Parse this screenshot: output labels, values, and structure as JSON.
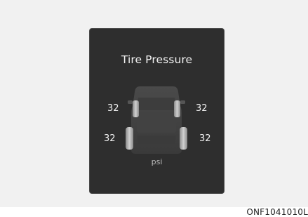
{
  "screen": {
    "title": "Tire Pressure",
    "unit": "psi"
  },
  "tires": {
    "front_left": "32",
    "front_right": "32",
    "rear_left": "32",
    "rear_right": "32"
  },
  "figure_code": "ONF1041010L",
  "icons": [
    "car-top-view-icon"
  ],
  "colors": {
    "display_background": "#2e2e2e",
    "text": "#f2f2f2",
    "page_background": "#f1f1f1"
  }
}
